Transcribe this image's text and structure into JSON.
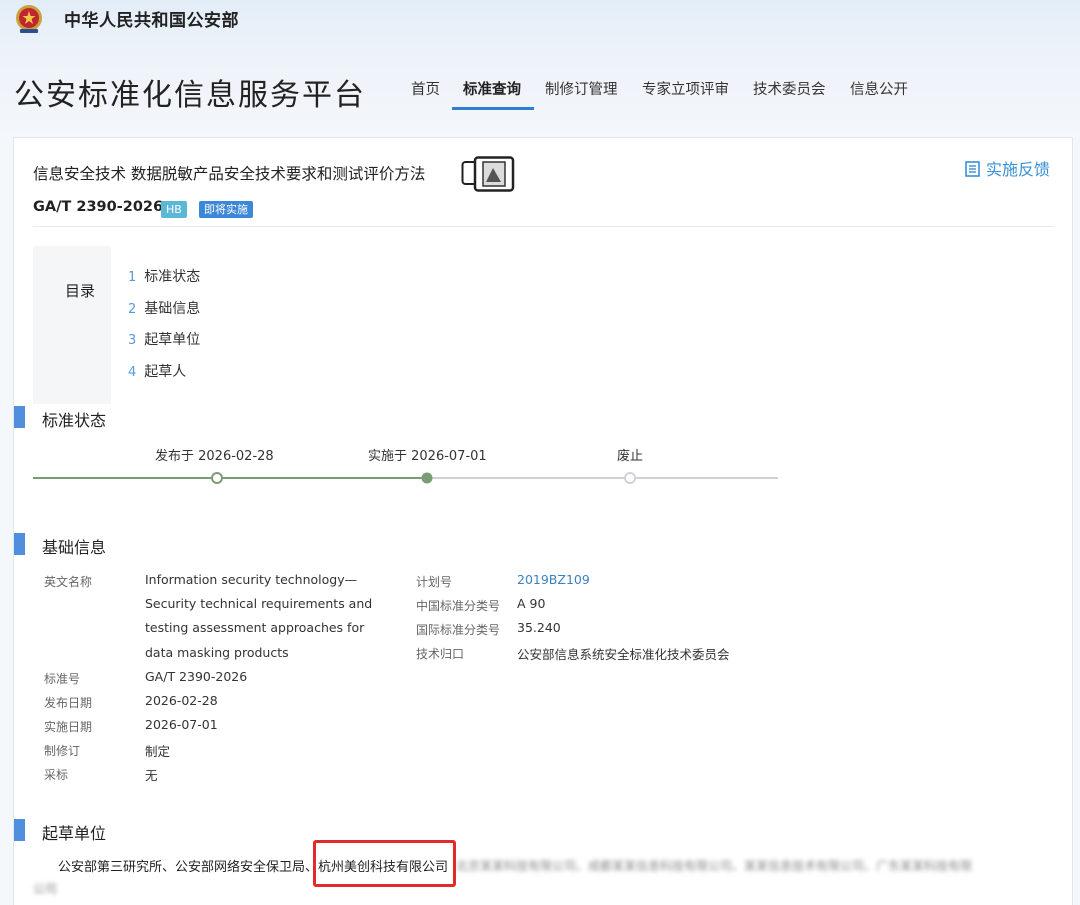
{
  "header": {
    "ministry_name": "中华人民共和国公安部",
    "platform_title": "公安标准化信息服务平台"
  },
  "nav": {
    "items": [
      {
        "label": "首页"
      },
      {
        "label": "标准查询",
        "active": true
      },
      {
        "label": "制修订管理"
      },
      {
        "label": "专家立项评审"
      },
      {
        "label": "技术委员会"
      },
      {
        "label": "信息公开"
      }
    ]
  },
  "document": {
    "title": "信息安全技术 数据脱敏产品安全技术要求和测试评价方法",
    "code": "GA/T 2390-2026",
    "badges": [
      "HB",
      "即将实施"
    ],
    "feedback_label": "实施反馈"
  },
  "toc": {
    "title": "目录",
    "items": [
      {
        "num": "1",
        "label": "标准状态"
      },
      {
        "num": "2",
        "label": "基础信息"
      },
      {
        "num": "3",
        "label": "起草单位"
      },
      {
        "num": "4",
        "label": "起草人"
      }
    ]
  },
  "status_section": {
    "title": "标准状态",
    "timeline": [
      {
        "label": "发布于 2026-02-28",
        "state": "passed"
      },
      {
        "label": "实施于 2026-07-01",
        "state": "current"
      },
      {
        "label": "废止",
        "state": "pending"
      }
    ],
    "colors": {
      "active": "#7a9c73",
      "pending": "#cfd3d8"
    }
  },
  "basic_info": {
    "title": "基础信息",
    "left": [
      {
        "label": "英文名称",
        "value": "Information security technology—Security technical requirements and testing assessment approaches for data masking products"
      },
      {
        "label": "标准号",
        "value": "GA/T 2390-2026"
      },
      {
        "label": "发布日期",
        "value": "2026-02-28"
      },
      {
        "label": "实施日期",
        "value": "2026-07-01"
      },
      {
        "label": "制修订",
        "value": "制定"
      },
      {
        "label": "采标",
        "value": "无"
      }
    ],
    "right": [
      {
        "label": "计划号",
        "value": "2019BZ109"
      },
      {
        "label": "中国标准分类号",
        "value": "A 90"
      },
      {
        "label": "国际标准分类号",
        "value": "35.240"
      },
      {
        "label": "技术归口",
        "value": "公安部信息系统安全标准化技术委员会"
      }
    ]
  },
  "drafting_units": {
    "title": "起草单位",
    "visible_text": "公安部第三研究所、公安部网络安全保卫局、",
    "highlighted": "杭州美创科技有限公司",
    "blurred_line1": "北京某某科技有限公司、成都某某信息科技有限公司、某某信息技术有限公司、广东某某科技有限",
    "blurred_line2": "公司"
  },
  "theme": {
    "accent": "#2f7fd1",
    "section_bar": "#4f8fdd",
    "highlight_border": "#e12a2a"
  }
}
